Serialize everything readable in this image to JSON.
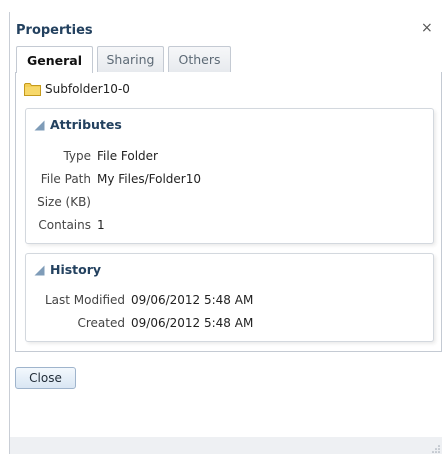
{
  "dialog": {
    "title": "Properties",
    "close_glyph": "×"
  },
  "tabs": [
    {
      "label": "General",
      "active": true
    },
    {
      "label": "Sharing",
      "active": false
    },
    {
      "label": "Others",
      "active": false
    }
  ],
  "item": {
    "name": "Subfolder10-0",
    "icon": "folder-icon"
  },
  "attributes": {
    "header": "Attributes",
    "rows": [
      {
        "label": "Type",
        "value": "File Folder"
      },
      {
        "label": "File Path",
        "value": "My Files/Folder10"
      },
      {
        "label": "Size (KB)",
        "value": ""
      },
      {
        "label": "Contains",
        "value": "1"
      }
    ]
  },
  "history": {
    "header": "History",
    "rows": [
      {
        "label": "Last Modified",
        "value": "09/06/2012 5:48 AM"
      },
      {
        "label": "Created",
        "value": "09/06/2012 5:48 AM"
      }
    ]
  },
  "buttons": {
    "close_label": "Close"
  },
  "colors": {
    "title": "#23415f",
    "folder": "#f2c23a",
    "button_border": "#9fb4cc"
  }
}
